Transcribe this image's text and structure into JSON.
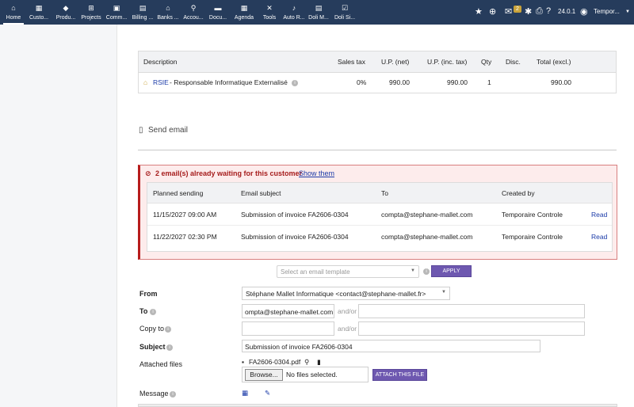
{
  "topbar": {
    "menu": [
      {
        "icon": "home-icon",
        "glyph": "⌂",
        "label": "Home"
      },
      {
        "icon": "building-icon",
        "glyph": "▦",
        "label": "Custo..."
      },
      {
        "icon": "cube-icon",
        "glyph": "◆",
        "label": "Produ..."
      },
      {
        "icon": "sitemap-icon",
        "glyph": "⊞",
        "label": "Projects"
      },
      {
        "icon": "briefcase-icon",
        "glyph": "▣",
        "label": "Comm..."
      },
      {
        "icon": "invoice-icon",
        "glyph": "▤",
        "label": "Billing ..."
      },
      {
        "icon": "bank-icon",
        "glyph": "⌂",
        "label": "Banks ..."
      },
      {
        "icon": "search-dollar-icon",
        "glyph": "⚲",
        "label": "Accou..."
      },
      {
        "icon": "folder-icon",
        "glyph": "▬",
        "label": "Docu..."
      },
      {
        "icon": "calendar-icon",
        "glyph": "▦",
        "label": "Agenda"
      },
      {
        "icon": "tools-icon",
        "glyph": "✕",
        "label": "Tools"
      },
      {
        "icon": "bell-icon",
        "glyph": "♪",
        "label": "Auto R..."
      },
      {
        "icon": "doc-icon",
        "glyph": "▤",
        "label": "Doli M..."
      },
      {
        "icon": "check-doc-icon",
        "glyph": "☑",
        "label": "Doli Si..."
      }
    ],
    "notif_count": "2",
    "version": "24.0.1",
    "user": "Tempor..."
  },
  "lines": {
    "headers": [
      "Description",
      "Sales tax",
      "U.P. (net)",
      "U.P. (inc. tax)",
      "Qty",
      "Disc.",
      "Total (excl.)"
    ],
    "row": {
      "ref": "RSIE",
      "desc": " - Responsable Informatique Externalisé",
      "vat": "0%",
      "pu_ht": "990.00",
      "pu_ttc": "990.00",
      "qty": "1",
      "disc": "",
      "total": "990.00"
    }
  },
  "send_email": "Send email",
  "alert": {
    "title": "2 email(s) already waiting for this customer",
    "link": "Show them",
    "headers": [
      "Planned sending",
      "Email subject",
      "To",
      "Created by"
    ],
    "rows": [
      {
        "date": "11/15/2027 09:00 AM",
        "subject": "Submission of invoice FA2606-0304",
        "to": "compta@stephane-mallet.com",
        "by": "Temporaire Controle",
        "action": "Read"
      },
      {
        "date": "11/22/2027 02:30 PM",
        "subject": "Submission of invoice FA2606-0304",
        "to": "compta@stephane-mallet.com",
        "by": "Temporaire Controle",
        "action": "Read"
      }
    ]
  },
  "form": {
    "template_placeholder": "Select an email template",
    "apply": "APPLY",
    "from_label": "From",
    "from_value": "Stéphane Mallet Informatique <contact@stephane-mallet.fr>",
    "to_label": "To",
    "to_value": "ompta@stephane-mallet.com",
    "andor": "and/or",
    "cc_label": "Copy to",
    "subject_label": "Subject",
    "subject_value": "Submission of invoice FA2606-0304",
    "attached_label": "Attached files",
    "attached_file": "FA2606-0304.pdf",
    "browse": "Browse...",
    "no_file": "No files selected.",
    "attach_btn": "ATTACH THIS FILE",
    "message_label": "Message"
  }
}
